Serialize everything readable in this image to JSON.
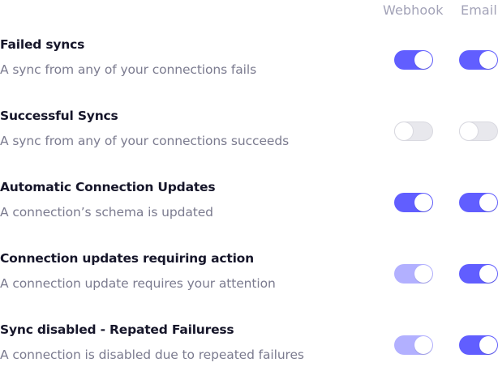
{
  "headers": {
    "webhook": "Webhook",
    "email": "Email"
  },
  "rows": [
    {
      "title": "Failed syncs",
      "description": "A sync from any of your connections fails",
      "webhook": {
        "state": "on",
        "enabled": true
      },
      "email": {
        "state": "on",
        "enabled": true
      }
    },
    {
      "title": "Successful Syncs",
      "description": "A sync from any of your connections succeeds",
      "webhook": {
        "state": "off",
        "enabled": true
      },
      "email": {
        "state": "off",
        "enabled": true
      }
    },
    {
      "title": "Automatic Connection Updates",
      "description": "A connection’s schema is updated",
      "webhook": {
        "state": "on",
        "enabled": true
      },
      "email": {
        "state": "on",
        "enabled": true
      }
    },
    {
      "title": "Connection updates requiring action",
      "description": "A connection update requires your attention",
      "webhook": {
        "state": "on",
        "enabled": false
      },
      "email": {
        "state": "on",
        "enabled": true
      }
    },
    {
      "title": "Sync disabled - Repated Failuress",
      "description": "A connection is disabled due to repeated failures",
      "webhook": {
        "state": "on",
        "enabled": false
      },
      "email": {
        "state": "on",
        "enabled": true
      }
    }
  ],
  "colors": {
    "toggle_on": "#615eff",
    "toggle_on_disabled": "#b2b0ff",
    "toggle_off": "#e8e8ed",
    "title_text": "#16162a",
    "description_text": "#7b7b8f",
    "header_text": "#a3a3b8"
  }
}
